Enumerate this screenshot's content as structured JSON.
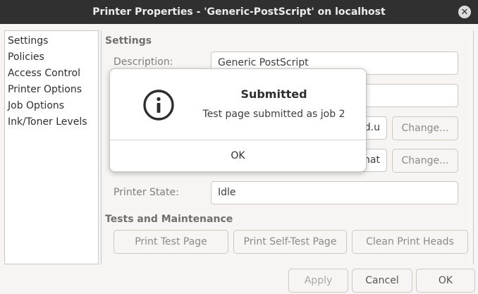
{
  "window": {
    "title": "Printer Properties - 'Generic-PostScript' on localhost",
    "close_glyph": "✕"
  },
  "sidebar": {
    "items": [
      {
        "label": "Settings"
      },
      {
        "label": "Policies"
      },
      {
        "label": "Access Control"
      },
      {
        "label": "Printer Options"
      },
      {
        "label": "Job Options"
      },
      {
        "label": "Ink/Toner Levels"
      }
    ]
  },
  "settings": {
    "section_title": "Settings",
    "description_label": "Description:",
    "description_value": "Generic PostScript",
    "location_value": "",
    "device_uri_fragment": "d.u",
    "make_model_fragment": "nat",
    "change_label": "Change...",
    "printer_state_label": "Printer State:",
    "printer_state_value": "Idle"
  },
  "tests": {
    "section_title": "Tests and Maintenance",
    "print_test_page": "Print Test Page",
    "print_self_test_page": "Print Self-Test Page",
    "clean_print_heads": "Clean Print Heads"
  },
  "footer": {
    "apply": "Apply",
    "cancel": "Cancel",
    "ok": "OK"
  },
  "dialog": {
    "icon": "info-icon",
    "title": "Submitted",
    "message": "Test page submitted as job 2",
    "ok": "OK"
  }
}
